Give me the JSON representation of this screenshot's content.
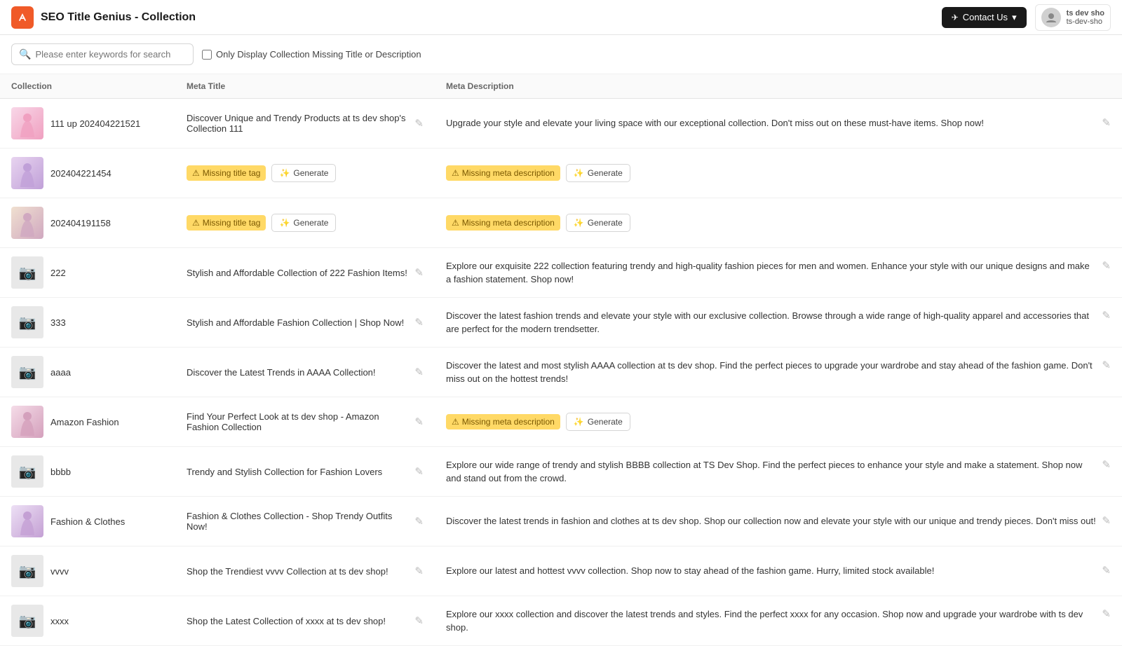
{
  "app": {
    "title": "SEO Title Genius - Collection",
    "logo_char": "🔥"
  },
  "header": {
    "contact_us_label": "Contact Us",
    "user_name": "ts dev sho",
    "user_handle": "ts-dev-sho",
    "chevron": "▾"
  },
  "toolbar": {
    "search_placeholder": "Please enter keywords for search",
    "filter_label": "Only Display Collection Missing Title or Description"
  },
  "table": {
    "col_collection": "Collection",
    "col_meta_title": "Meta Title",
    "col_meta_desc": "Meta Description"
  },
  "rows": [
    {
      "id": "row-1",
      "collection": "111 up 202404221521",
      "has_image": true,
      "image_type": "dress1",
      "meta_title": "Discover Unique and Trendy Products at ts dev shop's Collection 111",
      "meta_title_missing": false,
      "meta_desc": "Upgrade your style and elevate your living space with our exceptional collection. Don't miss out on these must-have items. Shop now!",
      "meta_desc_missing": false
    },
    {
      "id": "row-2",
      "collection": "202404221454",
      "has_image": true,
      "image_type": "dress2",
      "meta_title": "",
      "meta_title_missing": true,
      "meta_desc": "",
      "meta_desc_missing": true
    },
    {
      "id": "row-3",
      "collection": "202404191158",
      "has_image": true,
      "image_type": "dress3",
      "meta_title": "",
      "meta_title_missing": true,
      "meta_desc": "",
      "meta_desc_missing": true
    },
    {
      "id": "row-4",
      "collection": "222",
      "has_image": false,
      "image_type": "placeholder",
      "meta_title": "Stylish and Affordable Collection of 222 Fashion Items!",
      "meta_title_missing": false,
      "meta_desc": "Explore our exquisite 222 collection featuring trendy and high-quality fashion pieces for men and women. Enhance your style with our unique designs and make a fashion statement. Shop now!",
      "meta_desc_missing": false
    },
    {
      "id": "row-5",
      "collection": "333",
      "has_image": false,
      "image_type": "placeholder",
      "meta_title": "Stylish and Affordable Fashion Collection | Shop Now!",
      "meta_title_missing": false,
      "meta_desc": "Discover the latest fashion trends and elevate your style with our exclusive collection. Browse through a wide range of high-quality apparel and accessories that are perfect for the modern trendsetter.",
      "meta_desc_missing": false
    },
    {
      "id": "row-6",
      "collection": "aaaa",
      "has_image": false,
      "image_type": "placeholder",
      "meta_title": "Discover the Latest Trends in AAAA Collection!",
      "meta_title_missing": false,
      "meta_desc": "Discover the latest and most stylish AAAA collection at ts dev shop. Find the perfect pieces to upgrade your wardrobe and stay ahead of the fashion game. Don't miss out on the hottest trends!",
      "meta_desc_missing": false
    },
    {
      "id": "row-7",
      "collection": "Amazon Fashion",
      "has_image": true,
      "image_type": "amazon",
      "meta_title": "Find Your Perfect Look at ts dev shop - Amazon Fashion Collection",
      "meta_title_missing": false,
      "meta_desc": "",
      "meta_desc_missing": true
    },
    {
      "id": "row-8",
      "collection": "bbbb",
      "has_image": false,
      "image_type": "placeholder",
      "meta_title": "Trendy and Stylish Collection for Fashion Lovers",
      "meta_title_missing": false,
      "meta_desc": "Explore our wide range of trendy and stylish BBBB collection at TS Dev Shop. Find the perfect pieces to enhance your style and make a statement. Shop now and stand out from the crowd.",
      "meta_desc_missing": false
    },
    {
      "id": "row-9",
      "collection": "Fashion & Clothes",
      "has_image": true,
      "image_type": "fashion",
      "meta_title": "Fashion & Clothes Collection - Shop Trendy Outfits Now!",
      "meta_title_missing": false,
      "meta_desc": "Discover the latest trends in fashion and clothes at ts dev shop. Shop our collection now and elevate your style with our unique and trendy pieces. Don't miss out!",
      "meta_desc_missing": false
    },
    {
      "id": "row-10",
      "collection": "vvvv",
      "has_image": false,
      "image_type": "placeholder",
      "meta_title": "Shop the Trendiest vvvv Collection at ts dev shop!",
      "meta_title_missing": false,
      "meta_desc": "Explore our latest and hottest vvvv collection. Shop now to stay ahead of the fashion game. Hurry, limited stock available!",
      "meta_desc_missing": false
    },
    {
      "id": "row-11",
      "collection": "xxxx",
      "has_image": false,
      "image_type": "placeholder",
      "meta_title": "Shop the Latest Collection of xxxx at ts dev shop!",
      "meta_title_missing": false,
      "meta_desc": "Explore our xxxx collection and discover the latest trends and styles. Find the perfect xxxx for any occasion. Shop now and upgrade your wardrobe with ts dev shop.",
      "meta_desc_missing": false
    }
  ],
  "badges": {
    "missing_title": "Missing title tag",
    "missing_desc": "Missing meta description",
    "generate": "Generate"
  }
}
